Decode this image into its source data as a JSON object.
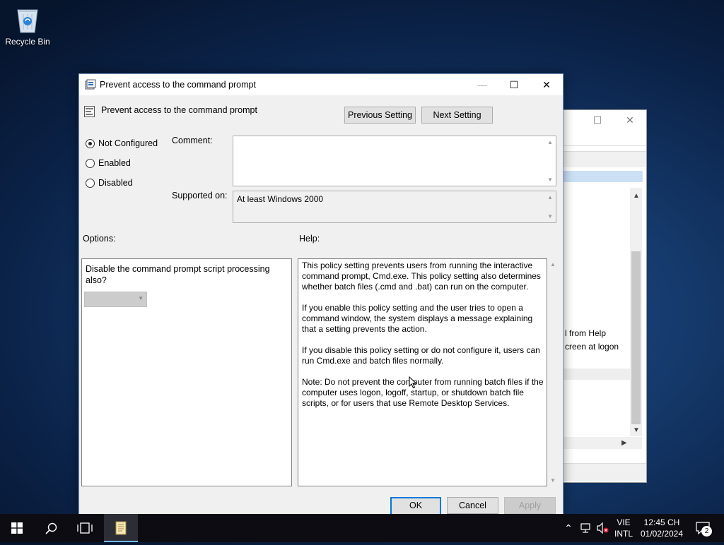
{
  "desktop": {
    "recycle_bin_label": "Recycle Bin"
  },
  "background_window": {
    "restore_glyph": "☐",
    "close_glyph": "✕",
    "line1": "l from Help",
    "line2": "creen at logon"
  },
  "dialog": {
    "title": "Prevent access to the command prompt",
    "setting_name": "Prevent access to the command prompt",
    "buttons": {
      "previous": "Previous Setting",
      "next": "Next Setting",
      "ok": "OK",
      "cancel": "Cancel",
      "apply": "Apply"
    },
    "state_options": [
      {
        "label": "Not Configured",
        "selected": true
      },
      {
        "label": "Enabled",
        "selected": false
      },
      {
        "label": "Disabled",
        "selected": false
      }
    ],
    "comment_label": "Comment:",
    "comment_value": "",
    "supported_label": "Supported on:",
    "supported_value": "At least Windows 2000",
    "options_label": "Options:",
    "help_label": "Help:",
    "option_question": "Disable the command prompt script processing also?",
    "option_combo_value": "",
    "help_paragraphs": [
      "This policy setting prevents users from running the interactive command prompt, Cmd.exe.  This policy setting also determines whether batch files (.cmd and .bat) can run on the computer.",
      "If you enable this policy setting and the user tries to open a command window, the system displays a message explaining that a setting prevents the action.",
      "If you disable this policy setting or do not configure it, users can run Cmd.exe and batch files normally.",
      "Note: Do not prevent the computer from running batch files if the computer uses logon, logoff, startup, or shutdown batch file scripts, or for users that use Remote Desktop Services."
    ]
  },
  "taskbar": {
    "language_top": "VIE",
    "language_bottom": "INTL",
    "time": "12:45 CH",
    "date": "01/02/2024",
    "notification_count": "2"
  },
  "colors": {
    "accent": "#0078d7",
    "desktop": "#143869",
    "taskbar": "#0c0c12"
  }
}
